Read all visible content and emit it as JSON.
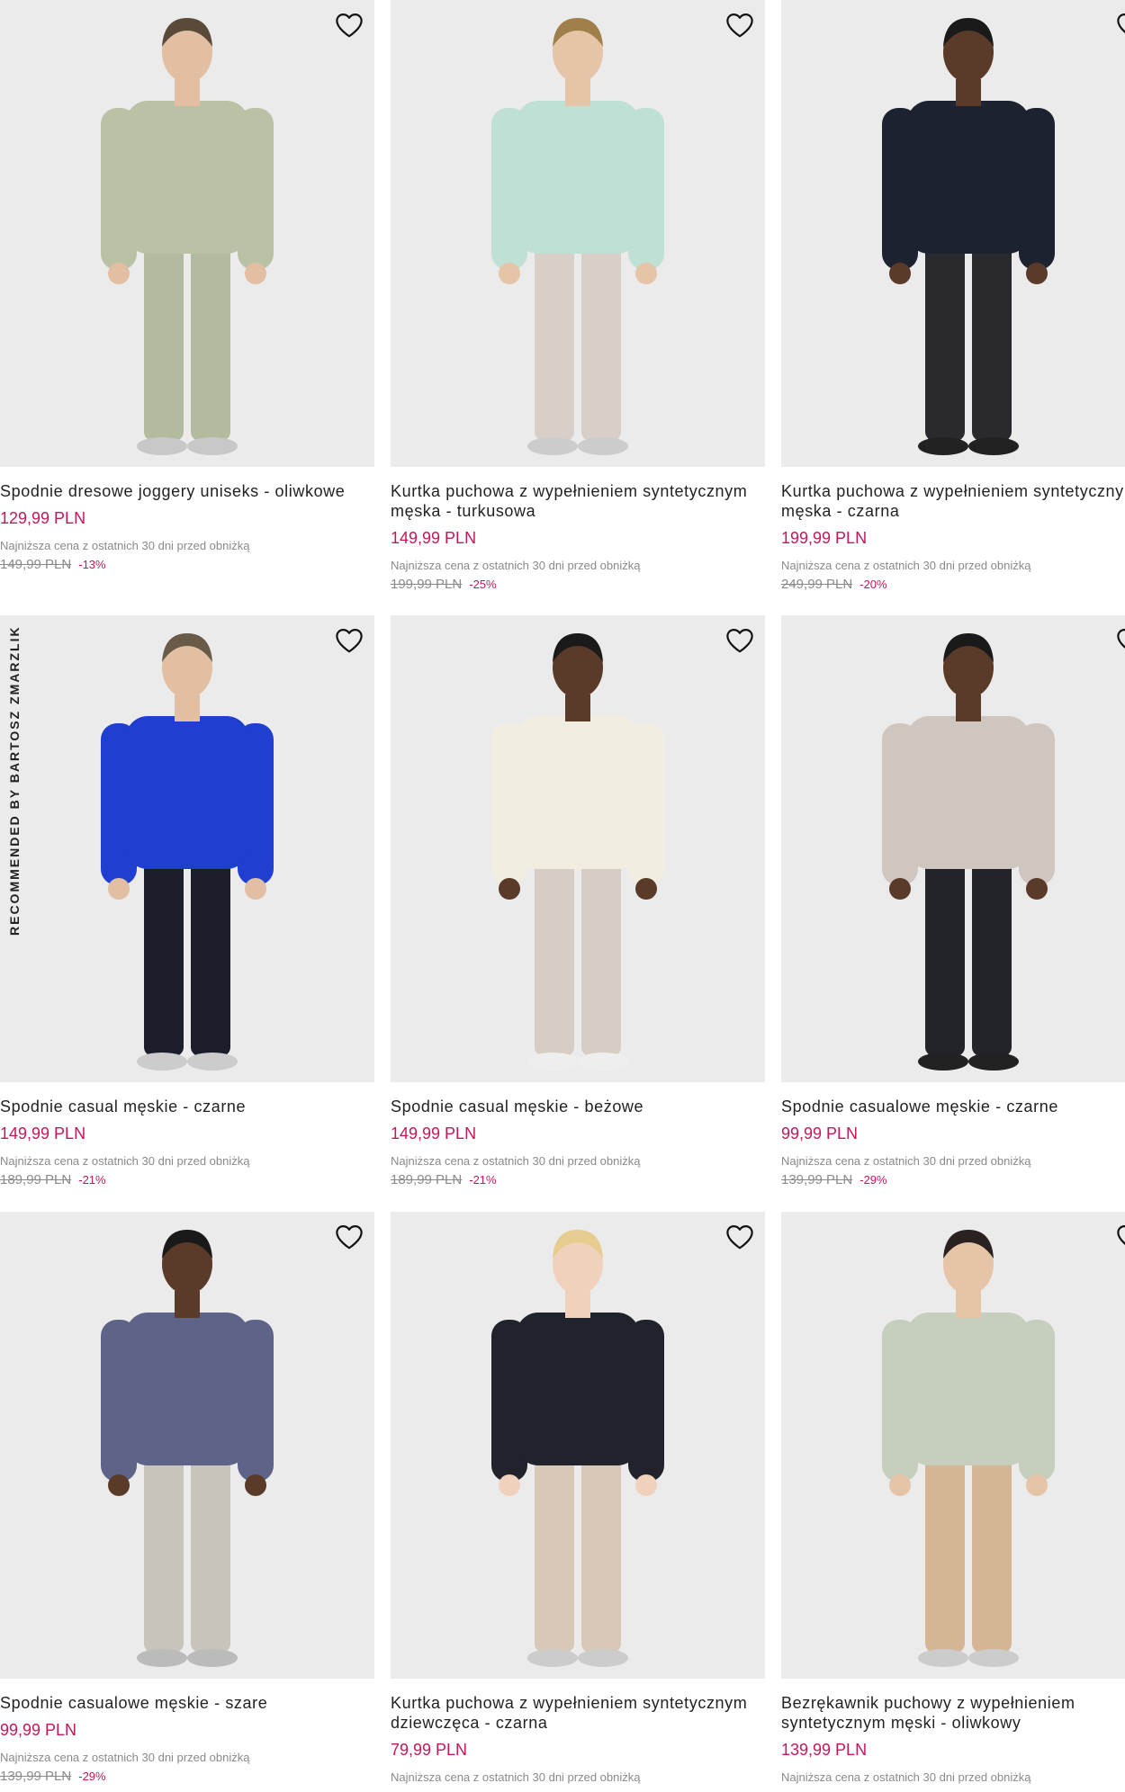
{
  "side_label": "RECOMMENDED BY BARTOSZ ZMARZLIK",
  "lowest_label": "Najniższa cena z ostatnich 30 dni przed obniżką",
  "products": [
    {
      "title": "Spodnie dresowe joggery uniseks - oliwkowe",
      "price": "129,99 PLN",
      "old_price": "149,99 PLN",
      "discount": "-13%",
      "colors": {
        "top": "#b9c2a5",
        "bottom": "#b3bb9e",
        "skin": "#e2bfa3",
        "hair": "#5a4a3a",
        "shoes": "#c8c8c8"
      }
    },
    {
      "title": "Kurtka puchowa z wypełnieniem syntetycznym męska - turkusowa",
      "price": "149,99 PLN",
      "old_price": "199,99 PLN",
      "discount": "-25%",
      "colors": {
        "top": "#bfe0d5",
        "bottom": "#d8d0c8",
        "skin": "#e6c4a8",
        "hair": "#a0804a",
        "shoes": "#cccccc"
      }
    },
    {
      "title": "Kurtka puchowa z wypełnieniem syntetycznym męska - czarna",
      "price": "199,99 PLN",
      "old_price": "249,99 PLN",
      "discount": "-20%",
      "colors": {
        "top": "#1c2230",
        "bottom": "#2a2a2e",
        "skin": "#5a3a28",
        "hair": "#1a1a1a",
        "shoes": "#222222"
      }
    },
    {
      "title": "Spodnie casual męskie - czarne",
      "price": "149,99 PLN",
      "old_price": "189,99 PLN",
      "discount": "-21%",
      "colors": {
        "top": "#1e3fcf",
        "bottom": "#1b1d2a",
        "skin": "#e2bfa3",
        "hair": "#6a5a48",
        "shoes": "#cccccc"
      }
    },
    {
      "title": "Spodnie casual męskie - beżowe",
      "price": "149,99 PLN",
      "old_price": "189,99 PLN",
      "discount": "-21%",
      "colors": {
        "top": "#f1ede1",
        "bottom": "#d6cec4",
        "skin": "#5a3a28",
        "hair": "#1a1a1a",
        "shoes": "#eeeeee"
      }
    },
    {
      "title": "Spodnie casualowe męskie - czarne",
      "price": "99,99 PLN",
      "old_price": "139,99 PLN",
      "discount": "-29%",
      "colors": {
        "top": "#cfc7bf",
        "bottom": "#23242a",
        "skin": "#5a3a28",
        "hair": "#1a1a1a",
        "shoes": "#222222"
      }
    },
    {
      "title": "Spodnie casualowe męskie - szare",
      "price": "99,99 PLN",
      "old_price": "139,99 PLN",
      "discount": "-29%",
      "colors": {
        "top": "#5e6488",
        "bottom": "#c8c4bc",
        "skin": "#5a3a28",
        "hair": "#1a1a1a",
        "shoes": "#bbbbbb"
      }
    },
    {
      "title": "Kurtka puchowa z wypełnieniem syntetycznym dziewczęca - czarna",
      "price": "79,99 PLN",
      "old_price": "",
      "discount": "",
      "colors": {
        "top": "#20232c",
        "bottom": "#d8c8b8",
        "skin": "#f0d2bc",
        "hair": "#e6cc8e",
        "shoes": "#cccccc"
      }
    },
    {
      "title": "Bezrękawnik puchowy z wypełnieniem syntetycznym męski - oliwkowy",
      "price": "139,99 PLN",
      "old_price": "",
      "discount": "",
      "colors": {
        "top": "#c6cfbd",
        "bottom": "#d4b594",
        "skin": "#e6c4a8",
        "hair": "#2a2220",
        "shoes": "#cccccc"
      }
    }
  ]
}
